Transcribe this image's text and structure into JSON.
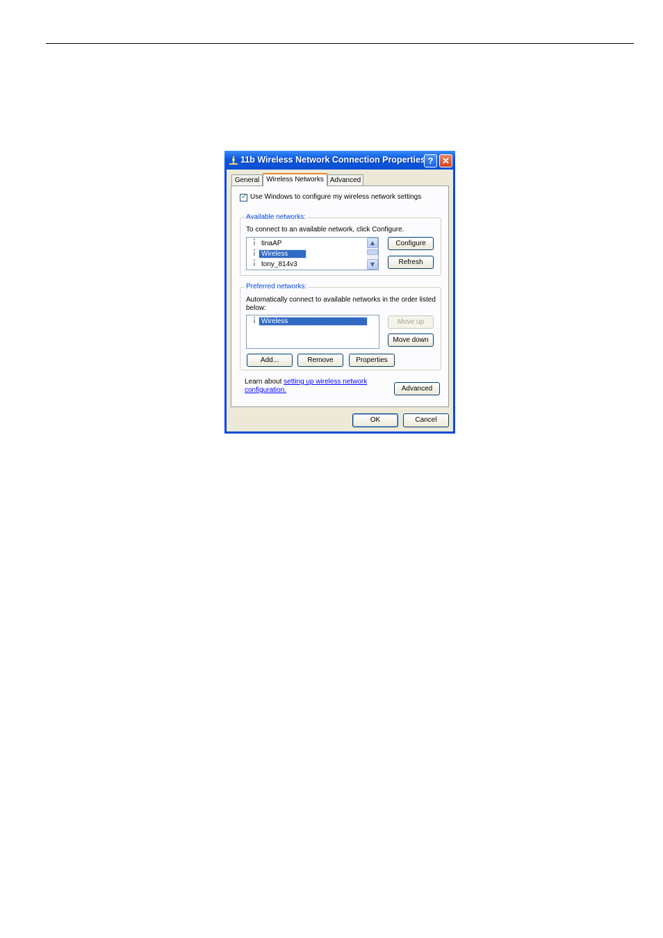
{
  "window": {
    "title": "11b Wireless Network Connection Properties",
    "help_glyph": "?",
    "close_glyph": "✕"
  },
  "tabs": [
    {
      "label": "General"
    },
    {
      "label": "Wireless Networks",
      "active": true
    },
    {
      "label": "Advanced"
    }
  ],
  "config_checkbox": {
    "label": "Use Windows to configure my wireless network settings",
    "checked": true
  },
  "available": {
    "legend": "Available networks:",
    "description": "To connect to an available network, click Configure.",
    "items": [
      {
        "name": "tinaAP",
        "selected": false
      },
      {
        "name": "Wireless",
        "selected": true
      },
      {
        "name": "tony_814v3",
        "selected": false
      }
    ],
    "configure_label": "Configure",
    "refresh_label": "Refresh"
  },
  "preferred": {
    "legend": "Preferred networks:",
    "description_line1": "Automatically connect to available networks in the order listed",
    "description_line2": "below:",
    "items": [
      {
        "name": "Wireless",
        "selected": true
      }
    ],
    "move_up_label": "Move up",
    "move_down_label": "Move down",
    "add_label": "Add...",
    "remove_label": "Remove",
    "properties_label": "Properties"
  },
  "learn": {
    "prefix": "Learn about ",
    "link_line1": "setting up wireless network",
    "link_line2": "configuration."
  },
  "advanced_button_label": "Advanced",
  "ok_label": "OK",
  "cancel_label": "Cancel",
  "colors": {
    "titlebar": "#0b58e0",
    "dialog_bg": "#ece9d8",
    "selection": "#316ac5",
    "tab_highlight": "#e68b2c"
  }
}
